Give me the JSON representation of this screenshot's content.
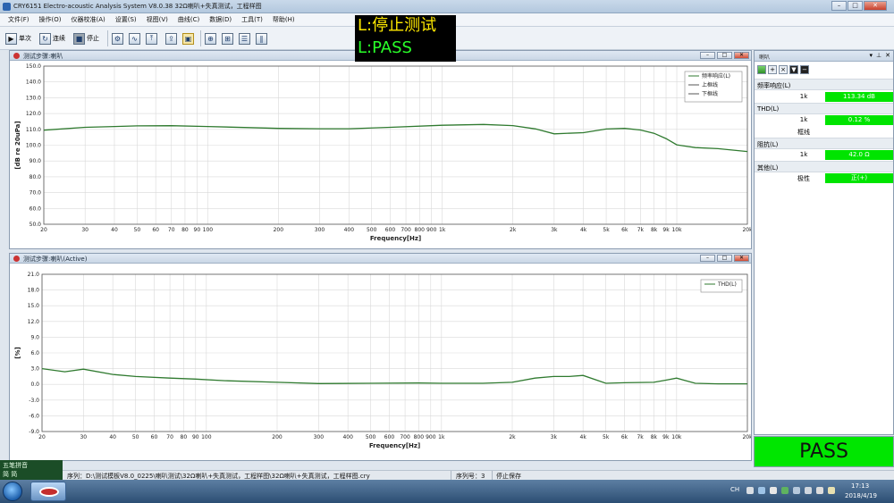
{
  "window": {
    "title": "CRY6151 Electro-acoustic Analysis System  V8.0.38 32Ω喇叭+失真测试，工程样图"
  },
  "menu": [
    "文件(F)",
    "操作(O)",
    "仪器校准(A)",
    "设置(S)",
    "视图(V)",
    "曲线(C)",
    "数据(D)",
    "工具(T)",
    "帮助(H)"
  ],
  "toolbar": {
    "single_label": "单次",
    "continuous_label": "连续",
    "stop_label": "停止"
  },
  "status_overlay": {
    "line1": "L:停止测试",
    "line2": "L:PASS"
  },
  "top_chart": {
    "title": "测试步骤:喇叭",
    "ylabel": "[dB re 20uPa]",
    "xlabel": "Frequency[Hz]",
    "legend": [
      "频率响应(L)",
      "上框线",
      "下框线"
    ]
  },
  "bottom_chart": {
    "title": "测试步骤:喇叭(Active)",
    "ylabel": "[%]",
    "xlabel": "Frequency[Hz]",
    "legend": [
      "THD(L)"
    ]
  },
  "x_tick_labels": [
    {
      "f": 20,
      "t": "20"
    },
    {
      "f": 30,
      "t": "30"
    },
    {
      "f": 40,
      "t": "40"
    },
    {
      "f": 50,
      "t": "50"
    },
    {
      "f": 60,
      "t": "60"
    },
    {
      "f": 70,
      "t": "70"
    },
    {
      "f": 80,
      "t": "80"
    },
    {
      "f": 90,
      "t": "90"
    },
    {
      "f": 100,
      "t": "100"
    },
    {
      "f": 200,
      "t": "200"
    },
    {
      "f": 300,
      "t": "300"
    },
    {
      "f": 400,
      "t": "400"
    },
    {
      "f": 500,
      "t": "500"
    },
    {
      "f": 600,
      "t": "600"
    },
    {
      "f": 700,
      "t": "700"
    },
    {
      "f": 800,
      "t": "800"
    },
    {
      "f": 900,
      "t": "900"
    },
    {
      "f": 1000,
      "t": "1k"
    },
    {
      "f": 2000,
      "t": "2k"
    },
    {
      "f": 3000,
      "t": "3k"
    },
    {
      "f": 4000,
      "t": "4k"
    },
    {
      "f": 5000,
      "t": "5k"
    },
    {
      "f": 6000,
      "t": "6k"
    },
    {
      "f": 7000,
      "t": "7k"
    },
    {
      "f": 8000,
      "t": "8k"
    },
    {
      "f": 9000,
      "t": "9k"
    },
    {
      "f": 10000,
      "t": "10k"
    },
    {
      "f": 20000,
      "t": "20k"
    }
  ],
  "chart_data": [
    {
      "type": "line",
      "title": "测试步骤:喇叭",
      "xlabel": "Frequency[Hz]",
      "ylabel": "[dB re 20uPa]",
      "xscale": "log",
      "xlim": [
        20,
        20000
      ],
      "ylim": [
        50,
        150
      ],
      "yticks": [
        "150.0",
        "140.0",
        "130.0",
        "120.0",
        "110.0",
        "100.0",
        "90.0",
        "80.0",
        "70.0",
        "60.0",
        "50.0"
      ],
      "grid": true,
      "legend_position": "top-right",
      "series": [
        {
          "name": "频率响应(L)",
          "x": [
            20,
            30,
            40,
            50,
            70,
            100,
            200,
            300,
            400,
            600,
            1000,
            1500,
            2000,
            2500,
            3000,
            4000,
            5000,
            6000,
            7000,
            8000,
            9000,
            10000,
            12000,
            15000,
            20000
          ],
          "y": [
            109.5,
            111.3,
            111.8,
            112.2,
            112.3,
            111.8,
            110.6,
            110.4,
            110.4,
            111.3,
            112.6,
            113.1,
            112.4,
            110.3,
            107.2,
            107.9,
            110.2,
            110.6,
            109.6,
            107.5,
            104.2,
            100.2,
            98.5,
            97.8,
            96.0
          ]
        }
      ]
    },
    {
      "type": "line",
      "title": "测试步骤:喇叭(Active)",
      "xlabel": "Frequency[Hz]",
      "ylabel": "[%]",
      "xscale": "log",
      "xlim": [
        20,
        20000
      ],
      "ylim": [
        -9,
        21
      ],
      "yticks": [
        "21.0",
        "18.0",
        "15.0",
        "12.0",
        "9.0",
        "6.0",
        "3.0",
        "0.0",
        "-3.0",
        "-6.0",
        "-9.0"
      ],
      "grid": true,
      "legend_position": "top-right",
      "series": [
        {
          "name": "THD(L)",
          "x": [
            20,
            25,
            30,
            40,
            50,
            70,
            90,
            120,
            200,
            300,
            500,
            800,
            1000,
            1500,
            2000,
            2500,
            3000,
            3500,
            4000,
            5000,
            6000,
            8000,
            9000,
            10000,
            12000,
            15000,
            20000
          ],
          "y": [
            3.0,
            2.4,
            2.9,
            1.9,
            1.5,
            1.2,
            1.0,
            0.7,
            0.4,
            0.15,
            0.2,
            0.25,
            0.2,
            0.2,
            0.4,
            1.2,
            1.5,
            1.5,
            1.7,
            0.2,
            0.3,
            0.4,
            0.8,
            1.2,
            0.2,
            0.1,
            0.1
          ]
        }
      ]
    }
  ],
  "right_panel": {
    "title": "喇叭",
    "groups": [
      {
        "title": "频率响应(L)",
        "rows": [
          {
            "name": "1k",
            "value": "113.34 dB"
          }
        ]
      },
      {
        "title": "THD(L)",
        "rows": [
          {
            "name": "1k",
            "value": "0.12 %"
          },
          {
            "name": "框线",
            "value": ""
          }
        ]
      },
      {
        "title": "阻抗(L)",
        "rows": [
          {
            "name": "1k",
            "value": "42.0 Ω"
          }
        ]
      },
      {
        "title": "其他(L)",
        "rows": [
          {
            "name": "极性",
            "value": "正(+)"
          }
        ]
      }
    ]
  },
  "pass_label": "PASS",
  "mini_dock": {
    "line1": "五笔拼音",
    "line2": "简 简"
  },
  "app_status": {
    "sequence": "序列：D:\\测试模板V8.0_0225\\喇叭测试\\32Ω喇叭+失真测试，工程样图\\32Ω喇叭+失真测试，工程样图.cry",
    "seq_no": "序列号：3",
    "state": "停止保存"
  },
  "taskbar": {
    "lang": "CH",
    "time": "17:13",
    "date": "2018/4/19"
  },
  "colors": {
    "curve": "#2f7a2f",
    "pass_bg": "#00e600",
    "value_bg": "#00e400",
    "overlay_line1": "#ffe900",
    "overlay_line2": "#29ff29"
  }
}
